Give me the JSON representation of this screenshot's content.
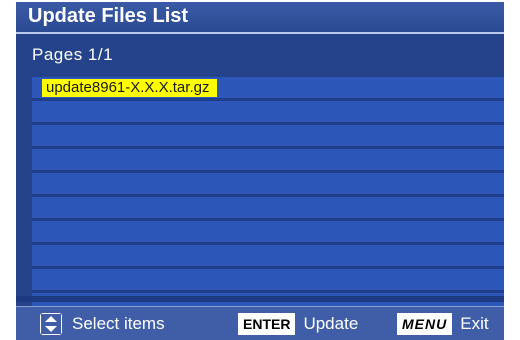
{
  "title": "Update Files List",
  "pages": "Pages  1/1",
  "files": [
    "update8961-X.X.X.tar.gz"
  ],
  "empty_rows": 9,
  "footer": {
    "select_label": "Select items",
    "enter_key": "ENTER",
    "enter_label": "Update",
    "menu_key": "MENU",
    "menu_label": "Exit"
  },
  "colors": {
    "background": "#25438a",
    "row": "#2c56b8",
    "highlight": "#ffff00"
  },
  "icons": [
    "up-down-arrow-icon"
  ]
}
